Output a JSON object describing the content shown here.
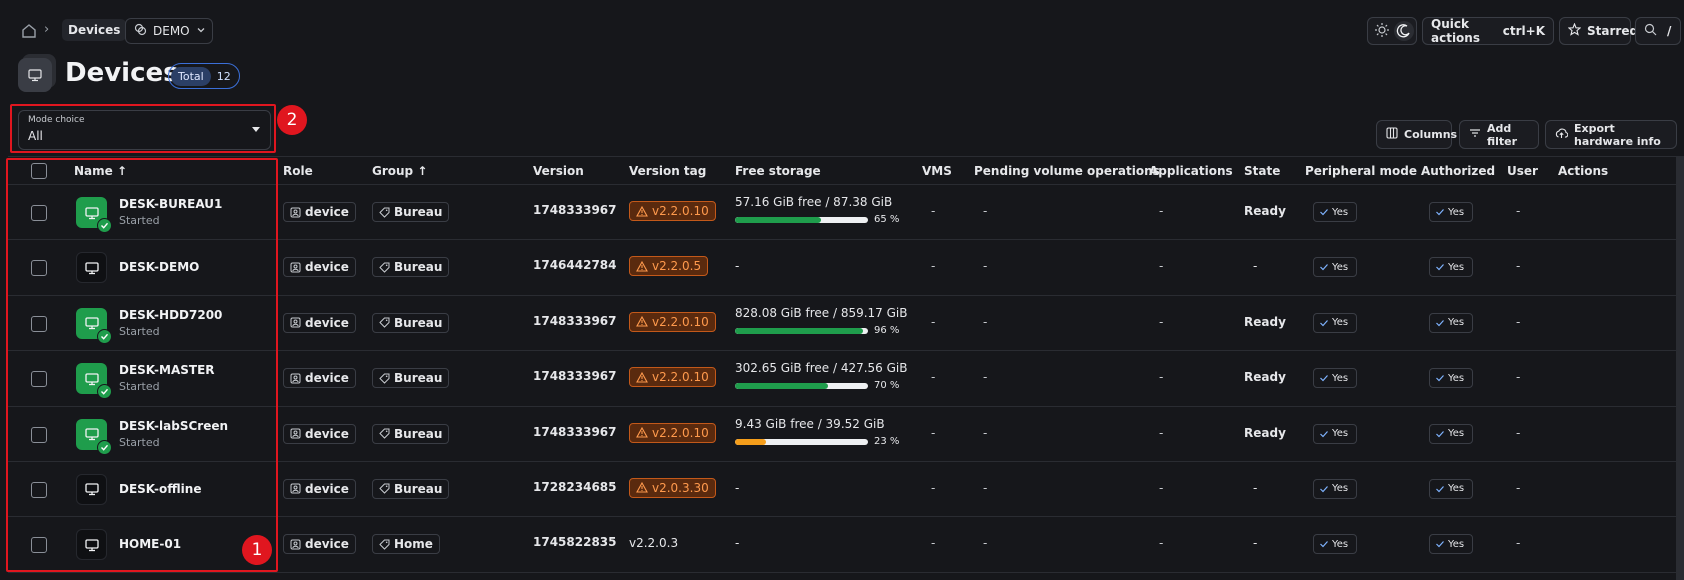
{
  "breadcrumb": {
    "current": "Devices"
  },
  "org_selector": {
    "value": "DEMO"
  },
  "top_right": {
    "quick_actions_label": "Quick actions",
    "quick_actions_shortcut": "ctrl+K",
    "starred_label": "Starred",
    "search_shortcut": "/"
  },
  "page": {
    "title": "Devices",
    "total_label": "Total",
    "total_count": "12"
  },
  "mode_choice": {
    "label": "Mode choice",
    "value": "All"
  },
  "annotations": {
    "one": "1",
    "two": "2"
  },
  "toolbar": {
    "columns_label": "Columns",
    "add_filter_label": "Add filter",
    "export_label": "Export hardware info"
  },
  "table": {
    "headers": [
      "Name",
      "Role",
      "Group",
      "Version",
      "Version tag",
      "Free storage",
      "VMS",
      "Pending volume operations",
      "Applications",
      "State",
      "Peripheral mode",
      "Authorized",
      "User",
      "Actions"
    ],
    "rows": [
      {
        "name": "DESK-BUREAU1",
        "status": "Started",
        "online": true,
        "role": "device",
        "group": "Bureau",
        "version": "1748333967",
        "version_tag": "v2.2.0.10",
        "tag_warn": true,
        "storage_free": "57.16 GiB free",
        "storage_total": "87.38 GiB",
        "storage_pct": 65,
        "storage_pct_label": "65 %",
        "storage_color": "#1f9d4c",
        "vms": "-",
        "pending": "-",
        "apps": "-",
        "state": "Ready",
        "peripheral": "Yes",
        "authorized": "Yes",
        "user": "-"
      },
      {
        "name": "DESK-DEMO",
        "status": "",
        "online": false,
        "role": "device",
        "group": "Bureau",
        "version": "1746442784",
        "version_tag": "v2.2.0.5",
        "tag_warn": true,
        "storage_free": "",
        "storage_total": "",
        "storage_pct": null,
        "storage_pct_label": "",
        "storage_color": "",
        "storage_dash": "-",
        "vms": "-",
        "pending": "-",
        "apps": "-",
        "state": "-",
        "peripheral": "Yes",
        "authorized": "Yes",
        "user": "-"
      },
      {
        "name": "DESK-HDD7200",
        "status": "Started",
        "online": true,
        "role": "device",
        "group": "Bureau",
        "version": "1748333967",
        "version_tag": "v2.2.0.10",
        "tag_warn": true,
        "storage_free": "828.08 GiB free",
        "storage_total": "859.17 GiB",
        "storage_pct": 96,
        "storage_pct_label": "96 %",
        "storage_color": "#1f9d4c",
        "vms": "-",
        "pending": "-",
        "apps": "-",
        "state": "Ready",
        "peripheral": "Yes",
        "authorized": "Yes",
        "user": "-"
      },
      {
        "name": "DESK-MASTER",
        "status": "Started",
        "online": true,
        "role": "device",
        "group": "Bureau",
        "version": "1748333967",
        "version_tag": "v2.2.0.10",
        "tag_warn": true,
        "storage_free": "302.65 GiB free",
        "storage_total": "427.56 GiB",
        "storage_pct": 70,
        "storage_pct_label": "70 %",
        "storage_color": "#1f9d4c",
        "vms": "-",
        "pending": "-",
        "apps": "-",
        "state": "Ready",
        "peripheral": "Yes",
        "authorized": "Yes",
        "user": "-"
      },
      {
        "name": "DESK-labSCreen",
        "status": "Started",
        "online": true,
        "role": "device",
        "group": "Bureau",
        "version": "1748333967",
        "version_tag": "v2.2.0.10",
        "tag_warn": true,
        "storage_free": "9.43 GiB free",
        "storage_total": "39.52 GiB",
        "storage_pct": 23,
        "storage_pct_label": "23 %",
        "storage_color": "#f59e1b",
        "vms": "-",
        "pending": "-",
        "apps": "-",
        "state": "Ready",
        "peripheral": "Yes",
        "authorized": "Yes",
        "user": "-"
      },
      {
        "name": "DESK-offline",
        "status": "",
        "online": false,
        "role": "device",
        "group": "Bureau",
        "version": "1728234685",
        "version_tag": "v2.0.3.30",
        "tag_warn": true,
        "storage_free": "",
        "storage_total": "",
        "storage_pct": null,
        "storage_pct_label": "",
        "storage_color": "",
        "storage_dash": "-",
        "vms": "-",
        "pending": "-",
        "apps": "-",
        "state": "-",
        "peripheral": "Yes",
        "authorized": "Yes",
        "user": "-"
      },
      {
        "name": "HOME-01",
        "status": "",
        "online": false,
        "role": "device",
        "group": "Home",
        "version": "1745822835",
        "version_tag": "v2.2.0.3",
        "tag_warn": false,
        "storage_free": "",
        "storage_total": "",
        "storage_pct": null,
        "storage_pct_label": "",
        "storage_color": "",
        "storage_dash": "-",
        "vms": "-",
        "pending": "-",
        "apps": "-",
        "state": "-",
        "peripheral": "Yes",
        "authorized": "Yes",
        "user": "-"
      }
    ]
  },
  "colors": {
    "accent_green": "#1f9d4c",
    "warn_orange": "#ff9a4d",
    "annotation_red": "#e0161f",
    "badge_blue": "#3b6fd8"
  }
}
